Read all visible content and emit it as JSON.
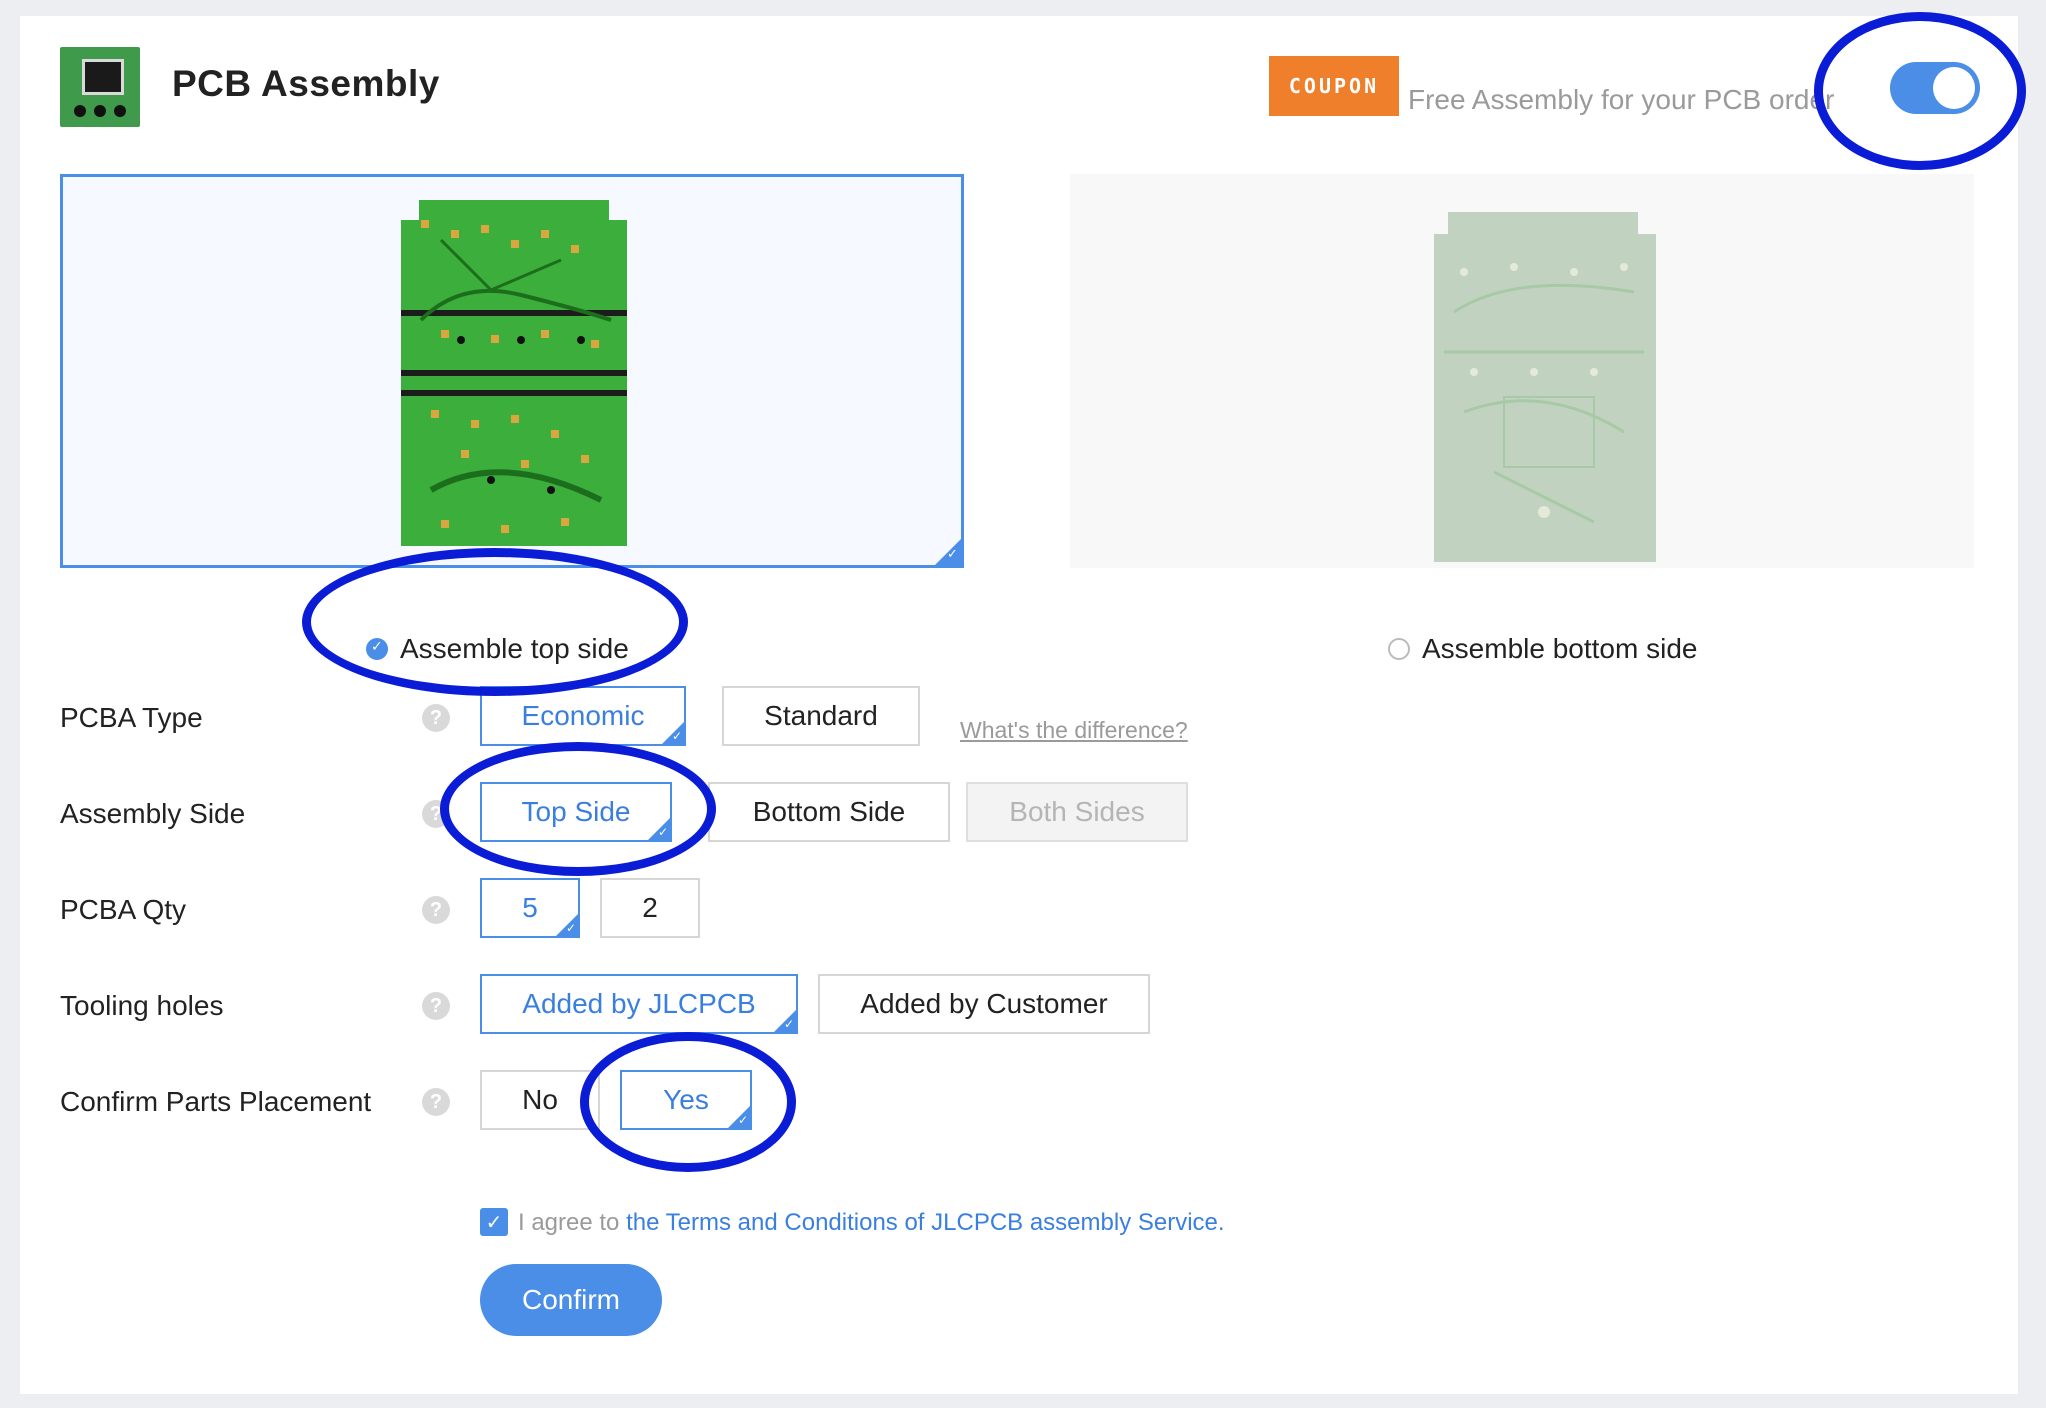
{
  "header": {
    "title": "PCB Assembly",
    "coupon_badge": "COUPON",
    "coupon_text": "Free Assembly for your PCB order",
    "assembly_toggle_on": true
  },
  "sides": {
    "top_label": "Assemble top side",
    "bottom_label": "Assemble bottom side",
    "selected": "top"
  },
  "form": {
    "pcba_type": {
      "label": "PCBA Type",
      "options": [
        "Economic",
        "Standard"
      ],
      "selected": "Economic",
      "diff_link": "What's the difference?"
    },
    "assembly_side": {
      "label": "Assembly Side",
      "options": [
        "Top Side",
        "Bottom Side",
        "Both Sides"
      ],
      "selected": "Top Side",
      "disabled": "Both Sides"
    },
    "pcba_qty": {
      "label": "PCBA Qty",
      "options": [
        "5",
        "2"
      ],
      "selected": "5"
    },
    "tooling_holes": {
      "label": "Tooling holes",
      "options": [
        "Added by JLCPCB",
        "Added by Customer"
      ],
      "selected": "Added by JLCPCB"
    },
    "confirm_parts_placement": {
      "label": "Confirm Parts Placement",
      "options": [
        "No",
        "Yes"
      ],
      "selected": "Yes"
    },
    "help_glyph": "?"
  },
  "agreement": {
    "checked": true,
    "prefix": "I agree to",
    "link": "the Terms and Conditions of JLCPCB assembly Service."
  },
  "confirm_button": "Confirm",
  "colors": {
    "accent": "#4a8ee8",
    "coupon": "#f07f2c",
    "annotation": "#0a1cd6",
    "pcb_green": "#3cae3c"
  }
}
